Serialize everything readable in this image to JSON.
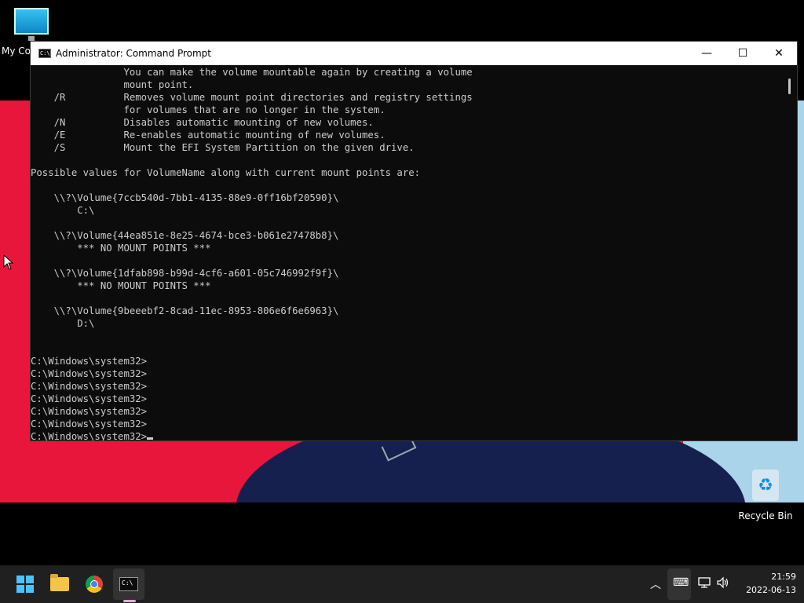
{
  "desktop": {
    "icons": [
      {
        "label": "My Co"
      },
      {
        "label": "Recycle Bin"
      }
    ]
  },
  "window": {
    "title": "Administrator: Command Prompt",
    "controls": {
      "minimize": "—",
      "maximize": "☐",
      "close": "✕"
    },
    "icon_text": "C:\\",
    "terminal_lines": [
      "                You can make the volume mountable again by creating a volume",
      "                mount point.",
      "    /R          Removes volume mount point directories and registry settings",
      "                for volumes that are no longer in the system.",
      "    /N          Disables automatic mounting of new volumes.",
      "    /E          Re-enables automatic mounting of new volumes.",
      "    /S          Mount the EFI System Partition on the given drive.",
      "",
      "Possible values for VolumeName along with current mount points are:",
      "",
      "    \\\\?\\Volume{7ccb540d-7bb1-4135-88e9-0ff16bf20590}\\",
      "        C:\\",
      "",
      "    \\\\?\\Volume{44ea851e-8e25-4674-bce3-b061e27478b8}\\",
      "        *** NO MOUNT POINTS ***",
      "",
      "    \\\\?\\Volume{1dfab898-b99d-4cf6-a601-05c746992f9f}\\",
      "        *** NO MOUNT POINTS ***",
      "",
      "    \\\\?\\Volume{9beeebf2-8cad-11ec-8953-806e6f6e6963}\\",
      "        D:\\",
      "",
      "",
      "C:\\Windows\\system32>",
      "C:\\Windows\\system32>",
      "C:\\Windows\\system32>",
      "C:\\Windows\\system32>",
      "C:\\Windows\\system32>",
      "C:\\Windows\\system32>"
    ],
    "prompt": "C:\\Windows\\system32>"
  },
  "taskbar": {
    "tray_chevron": "︿",
    "clock_time": "21:59",
    "clock_date": "2022-06-13"
  },
  "colors": {
    "terminal_bg": "#0c0c0c",
    "terminal_fg": "#cccccc",
    "taskbar_bg": "#202020",
    "accent": "#4cc2ff"
  }
}
